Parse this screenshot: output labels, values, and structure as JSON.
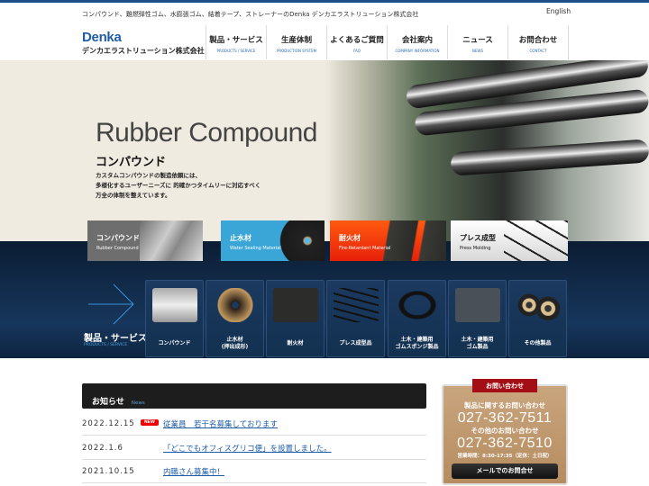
{
  "header": {
    "tagline": "コンパウンド、難燃弾性ゴム、水膨張ゴム、結着テープ、ストレーナーのDenka デンカエラストリューション株式会社",
    "english": "English",
    "logo_brand": "Denka",
    "logo_sub": "デンカエラストリューション株式会社"
  },
  "nav": [
    {
      "jp": "製品・サービス",
      "en": "PRODUCTS / SERVICE"
    },
    {
      "jp": "生産体制",
      "en": "PRODUCTION SYSTEM"
    },
    {
      "jp": "よくあるご質問",
      "en": "FAQ"
    },
    {
      "jp": "会社案内",
      "en": "COMPANY INFORMATION"
    },
    {
      "jp": "ニュース",
      "en": "NEWS"
    },
    {
      "jp": "お問合わせ",
      "en": "CONTACT"
    }
  ],
  "hero": {
    "title": "Rubber Compound",
    "subtitle": "コンパウンド",
    "desc": [
      "カスタムコンパウンドの製造依頼には、",
      "多様化するユーザーニーズに 的確かつタイムリーに対応すべく",
      "万全の体制を整えています。"
    ]
  },
  "categories": [
    {
      "jp": "コンパウンド",
      "en": "Rubber Compound"
    },
    {
      "jp": "止水材",
      "en": "Water Sealing Material"
    },
    {
      "jp": "耐火材",
      "en": "Fire-Retardant Material"
    },
    {
      "jp": "プレス成型",
      "en": "Press Molding"
    }
  ],
  "products_section": {
    "title": "製品・サービス",
    "en": "PRODUCTS / SERVICE"
  },
  "products": [
    {
      "l1": "コンパウンド",
      "l2": ""
    },
    {
      "l1": "止水材",
      "l2": "(押出成形)"
    },
    {
      "l1": "耐火材",
      "l2": ""
    },
    {
      "l1": "プレス成型品",
      "l2": ""
    },
    {
      "l1": "土木・建築用",
      "l2": "ゴムスポンジ製品"
    },
    {
      "l1": "土木・建築用",
      "l2": "ゴム製品"
    },
    {
      "l1": "その他製品",
      "l2": ""
    }
  ],
  "news": {
    "title": "お知らせ",
    "en": "News",
    "new_badge": "NEW",
    "items": [
      {
        "date": "2022.12.15",
        "title": "従業員　若干名募集しております",
        "is_new": true
      },
      {
        "date": "2022.1.6",
        "title": "「どこでもオフィスグリコ便」を設置しました。"
      },
      {
        "date": "2021.10.15",
        "title": "内職さん募集中！"
      }
    ]
  },
  "contact": {
    "tab": "お問い合わせ",
    "label1": "製品に関するお問い合わせ",
    "phone1": "027-362-7511",
    "label2": "その他のお問い合わせ",
    "phone2": "027-362-7510",
    "hours": "営業時間：8:30-17:35（定休：土日祝）",
    "mail_button": "メールでのお問合せ"
  }
}
